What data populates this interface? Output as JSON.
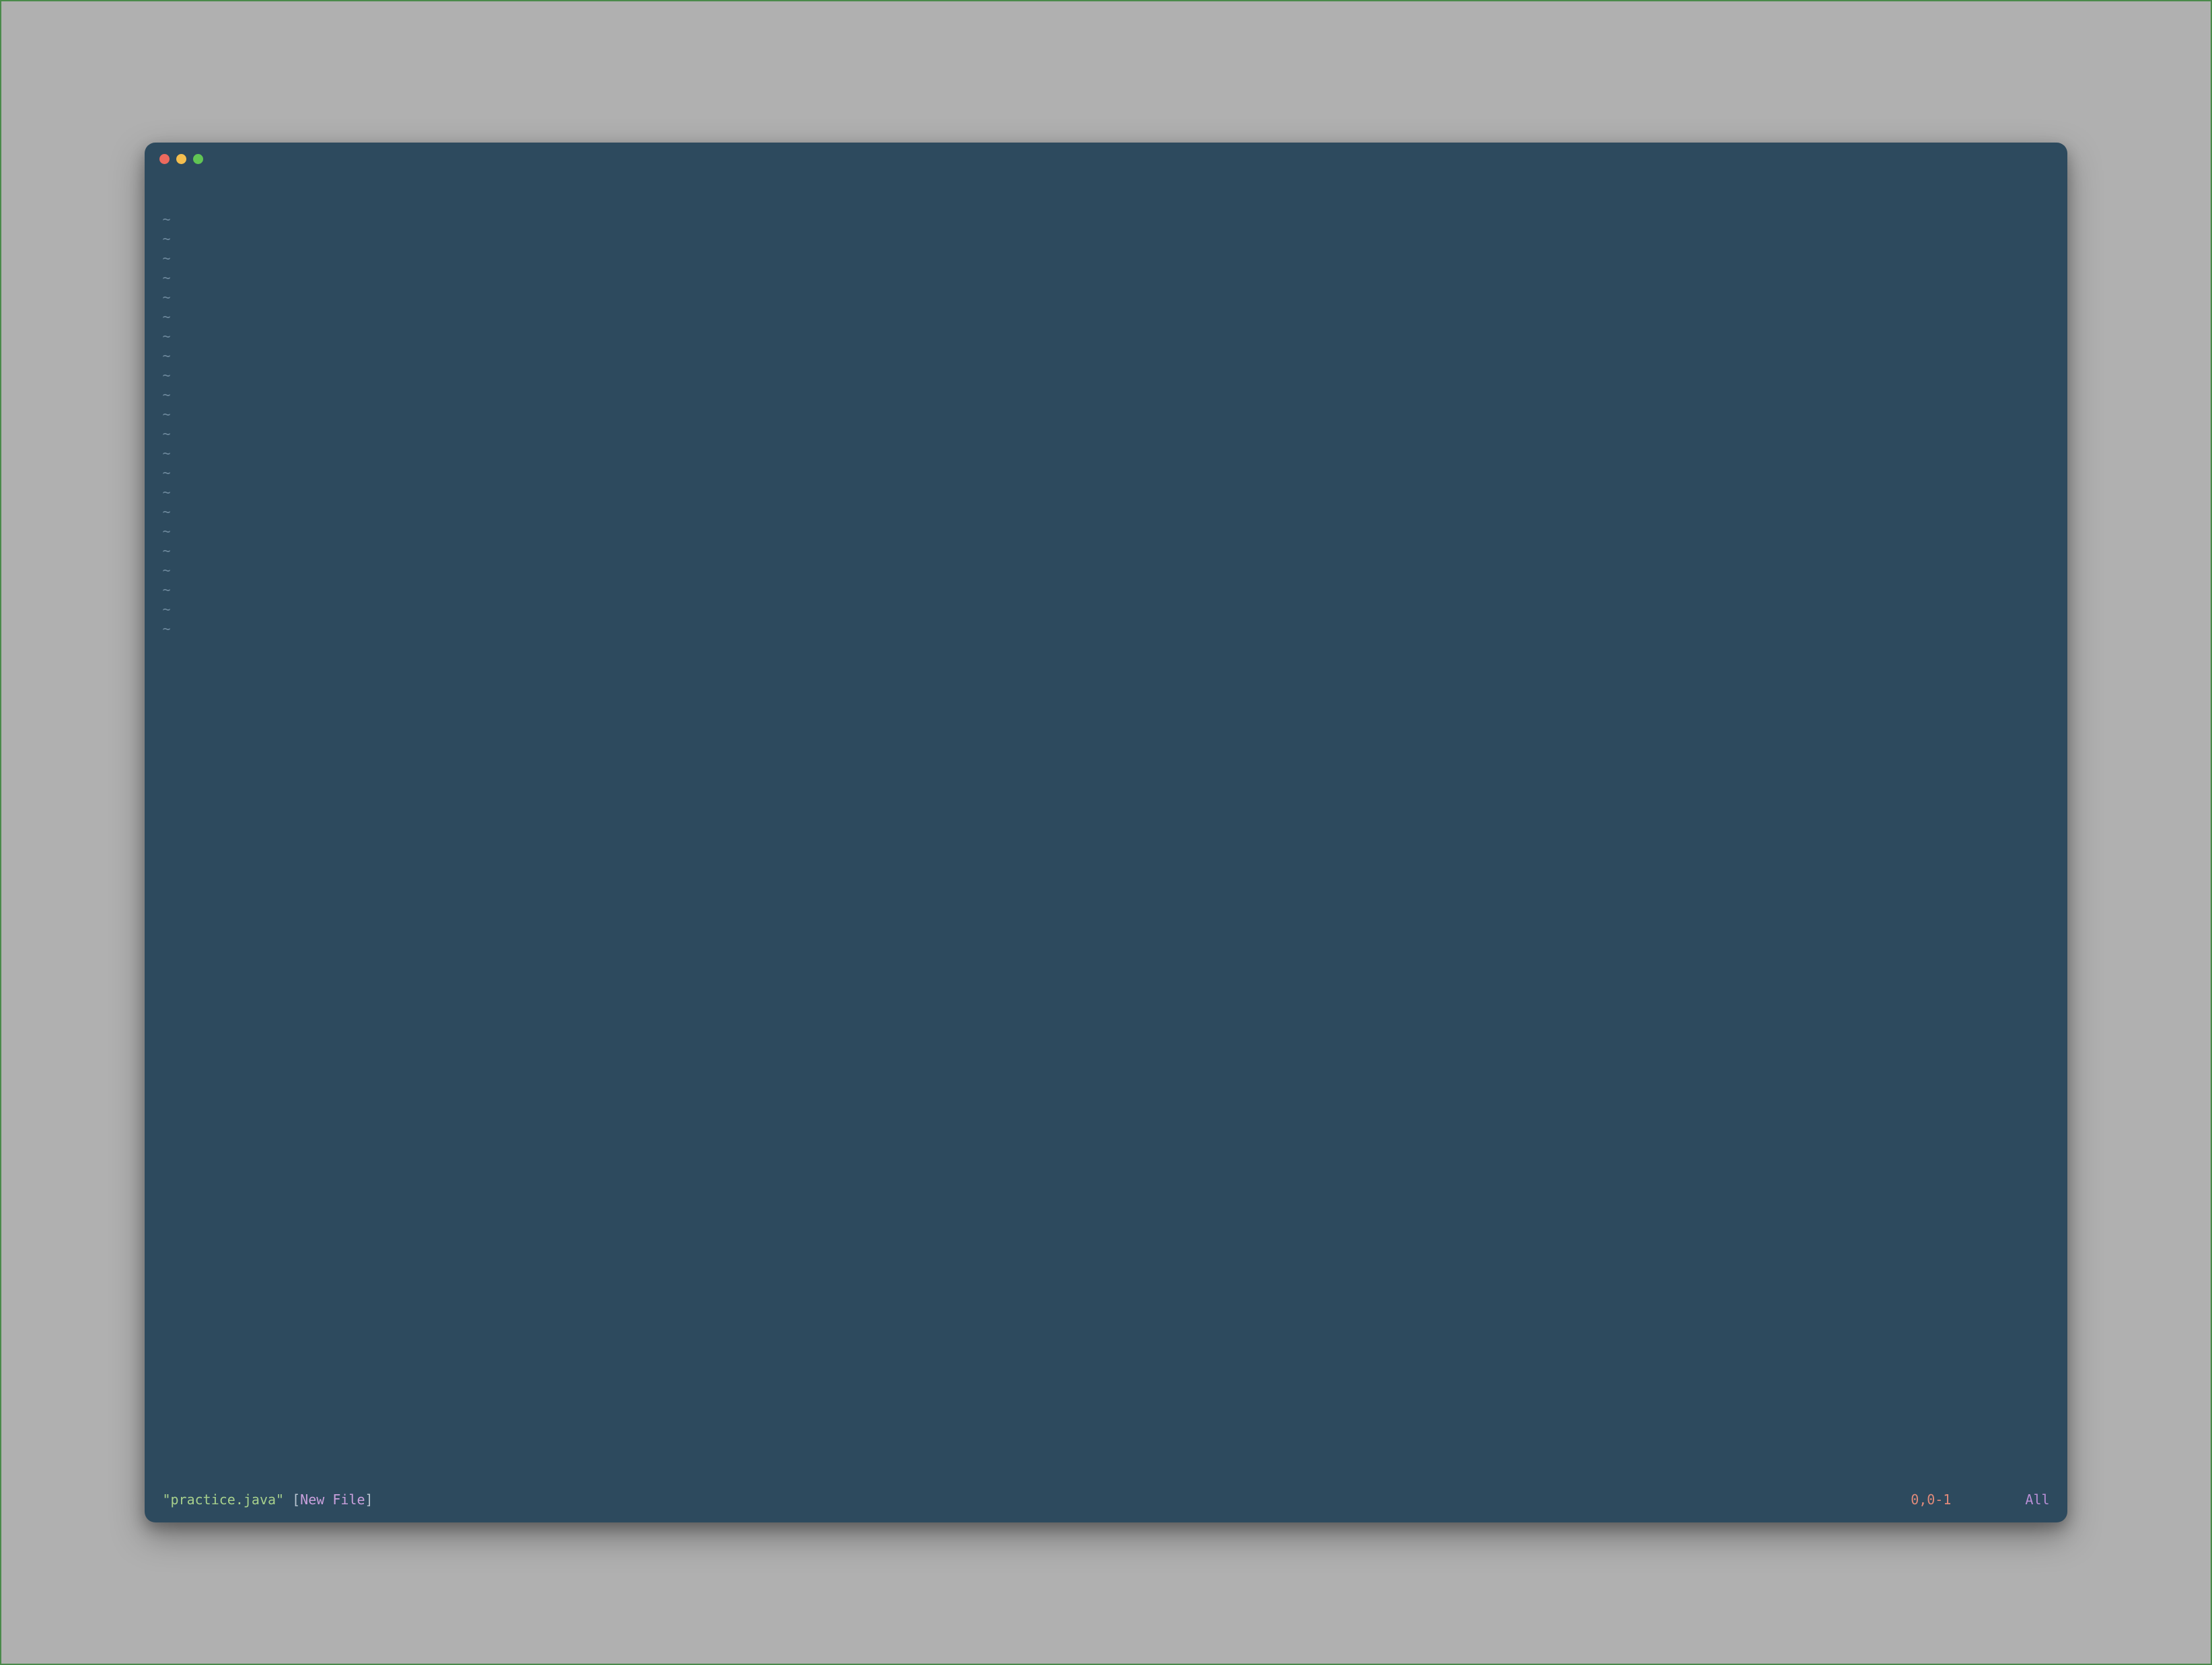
{
  "window": {
    "traffic_lights": [
      "close",
      "minimize",
      "zoom"
    ]
  },
  "editor": {
    "empty_line_marker": "~",
    "empty_line_count": 22
  },
  "status": {
    "filename": "\"practice.java\"",
    "space1": " ",
    "bracket_open": "[",
    "file_state": "New File",
    "bracket_close": "]",
    "cursor_position": "0,0-1",
    "scroll_indicator": "All"
  },
  "colors": {
    "background": "#2d4a5e",
    "tilde": "#6f8a9e",
    "filename": "#a7d08c",
    "newfile": "#c9a0dc",
    "position": "#e08a7a",
    "indicator": "#b98fd6"
  }
}
